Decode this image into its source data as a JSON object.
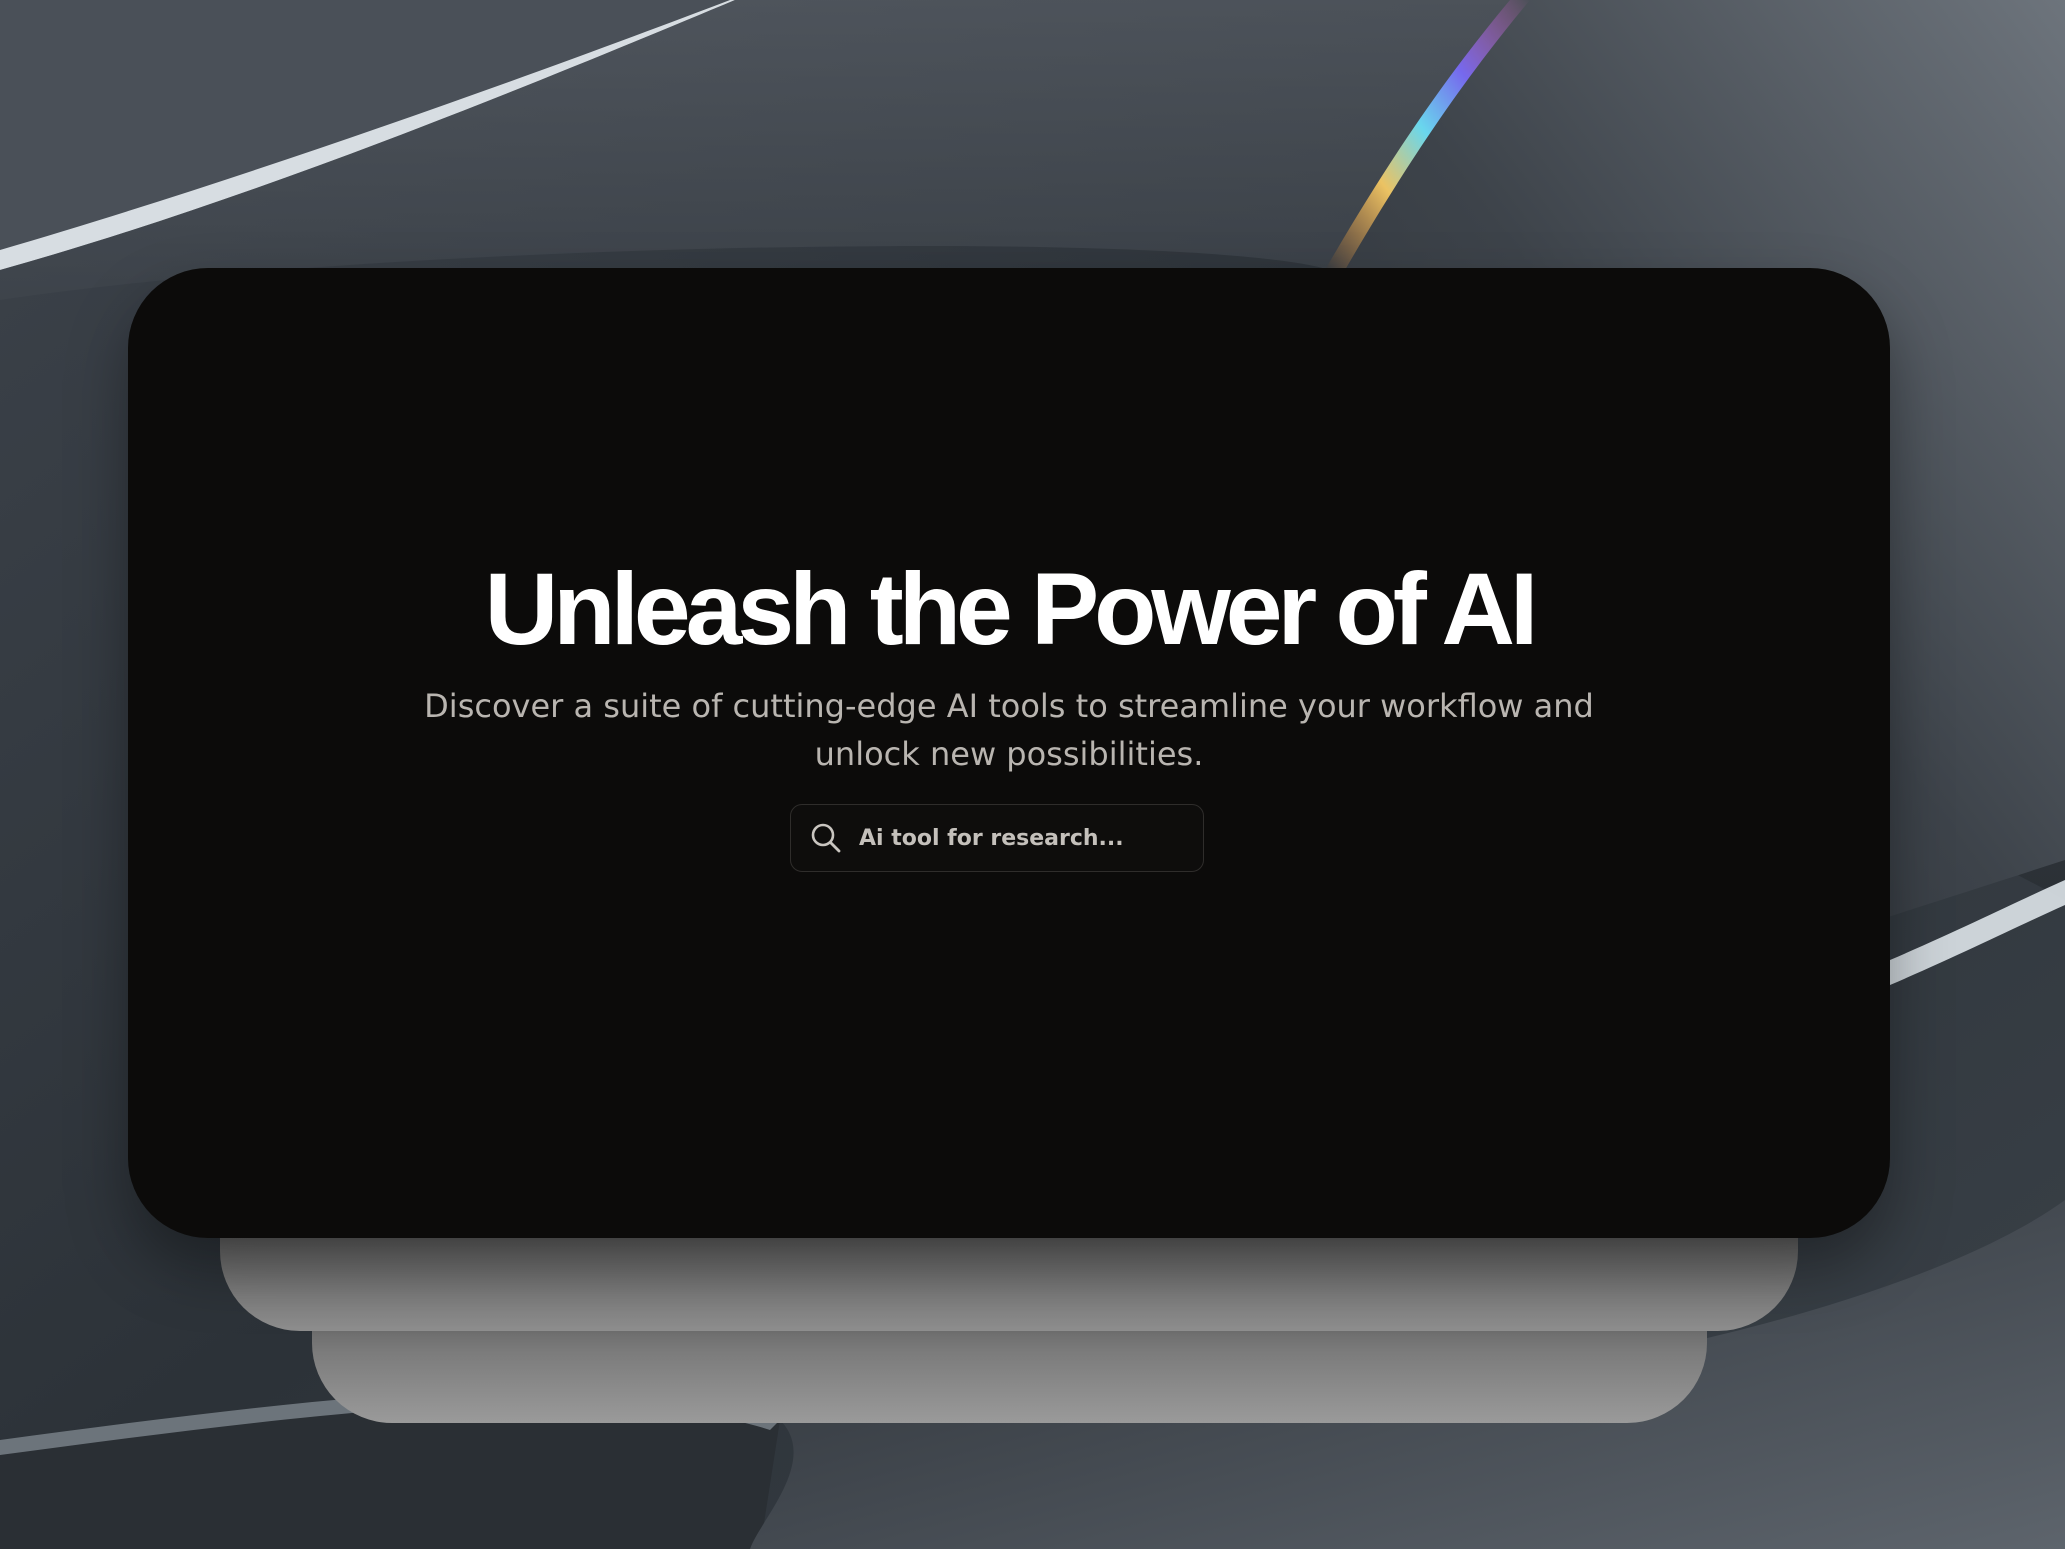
{
  "hero": {
    "title": "Unleash the Power of AI",
    "subtitle": "Discover a suite of cutting-edge AI tools to streamline your workflow and unlock new possibilities."
  },
  "search": {
    "placeholder": "Ai tool for research...",
    "value": "",
    "icon": "search-icon"
  },
  "colors": {
    "card_background": "#0c0b0a",
    "title_text": "#ffffff",
    "subtitle_text": "#b9b5b0",
    "wallpaper_base": "#2f353c"
  }
}
